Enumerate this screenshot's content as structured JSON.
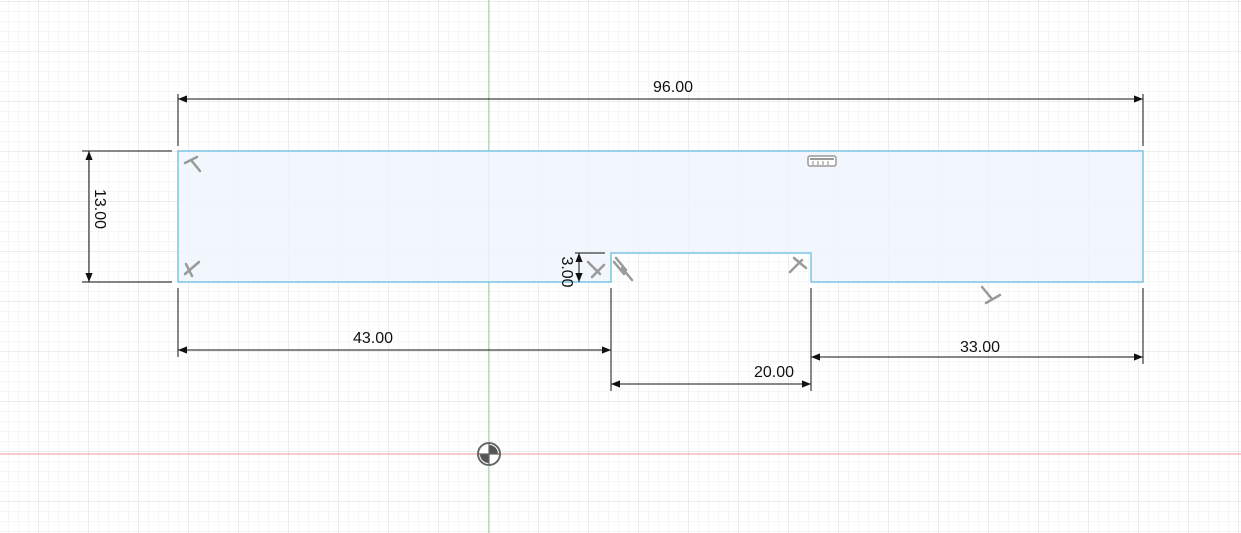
{
  "sketch": {
    "fill_color": "#eef6fb",
    "edge_color": "#7cc4e4",
    "grid_minor_color": "#ececec",
    "grid_major_color": "#d8d8d8",
    "x_axis_color": "#ef9a9a",
    "y_axis_color": "#a5d6a7",
    "dimension_color": "#111111",
    "constraint_icon_color": "#9a9a9a"
  },
  "dimensions": {
    "overall_width": "96.00",
    "height": "13.00",
    "slot_depth": "3.00",
    "left_segment": "43.00",
    "slot_width": "20.00",
    "right_segment": "33.00"
  },
  "icons": {
    "origin": "origin-icon",
    "constraint_perpendicular": "perpendicular-constraint-icon",
    "constraint_horizontal": "horizontal-constraint-icon"
  }
}
